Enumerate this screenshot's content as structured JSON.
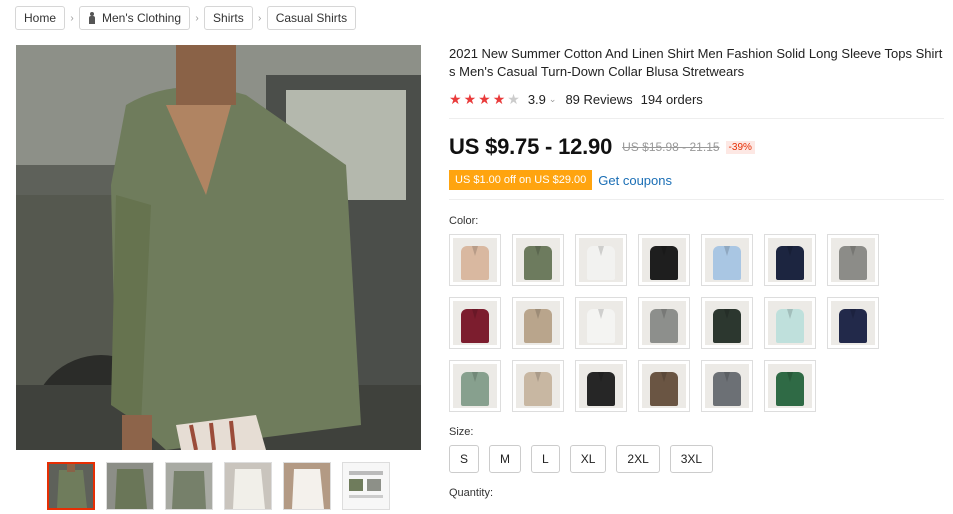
{
  "breadcrumb": {
    "items": [
      "Home",
      "Men's Clothing",
      "Shirts",
      "Casual Shirts"
    ]
  },
  "product": {
    "title": "2021 New Summer Cotton And Linen Shirt Men Fashion Solid Long Sleeve Tops Shirts Men's Casual Turn-Down Collar Blusa Stretwears",
    "rating": "3.9",
    "rating_value": 3.9,
    "reviews": "89 Reviews",
    "orders": "194 orders",
    "price": "US $9.75 - 12.90",
    "original_price": "US $15.98 - 21.15",
    "discount": "-39%",
    "coupon": "US $1.00 off on US $29.00",
    "get_coupons": "Get coupons"
  },
  "color_label": "Color:",
  "colors": [
    {
      "name": "beige-pattern",
      "hex": "#d9b8a0"
    },
    {
      "name": "army-green",
      "hex": "#6d7b5e"
    },
    {
      "name": "white",
      "hex": "#f2f2f0"
    },
    {
      "name": "black",
      "hex": "#1e1e1e"
    },
    {
      "name": "light-blue",
      "hex": "#a9c6e3"
    },
    {
      "name": "navy",
      "hex": "#1c2540"
    },
    {
      "name": "gray",
      "hex": "#8c8c88"
    },
    {
      "name": "wine-red",
      "hex": "#7c1d2e"
    },
    {
      "name": "khaki",
      "hex": "#b9a58c"
    },
    {
      "name": "white-v",
      "hex": "#f4f4f2"
    },
    {
      "name": "gray-v",
      "hex": "#8d8f8c"
    },
    {
      "name": "dark-green-v",
      "hex": "#2c372f"
    },
    {
      "name": "mint-v",
      "hex": "#bfe0dc"
    },
    {
      "name": "navy-v",
      "hex": "#22294a"
    },
    {
      "name": "sage-v",
      "hex": "#87a08e"
    },
    {
      "name": "beige-v",
      "hex": "#c8b7a2"
    },
    {
      "name": "black-stripe",
      "hex": "#262626"
    },
    {
      "name": "brown-stripe",
      "hex": "#6a5543"
    },
    {
      "name": "gray-stripe",
      "hex": "#6c7075"
    },
    {
      "name": "green-stripe",
      "hex": "#2f6a45"
    }
  ],
  "size_label": "Size:",
  "sizes": [
    "S",
    "M",
    "L",
    "XL",
    "2XL",
    "3XL"
  ],
  "quantity_label": "Quantity:"
}
